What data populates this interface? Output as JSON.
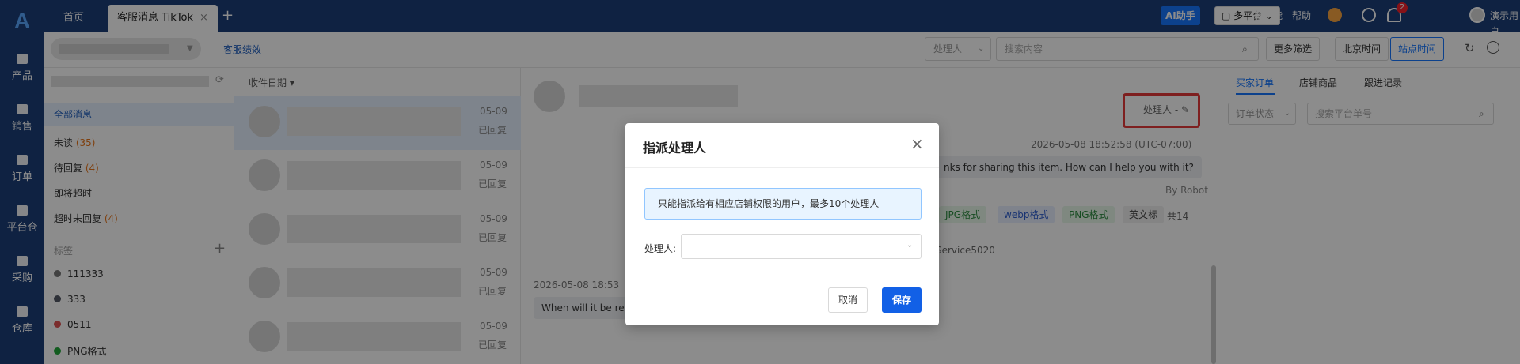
{
  "rail": {
    "items": [
      {
        "label": "产品"
      },
      {
        "label": "销售"
      },
      {
        "label": "订单"
      },
      {
        "label": "平台仓"
      },
      {
        "label": "采购"
      },
      {
        "label": "仓库"
      }
    ]
  },
  "topbar": {
    "tabs": [
      {
        "label": "首页",
        "active": false
      },
      {
        "label": "客服消息 TikTok",
        "active": true
      }
    ],
    "tab_close": "×",
    "add_tab": "+",
    "ai_label": "AI助手",
    "platform_label": "多平台",
    "new_features": "新功能",
    "help": "帮助",
    "notification_count": "2",
    "user_name": "演示用户"
  },
  "subbar": {
    "kefu_link": "客服绩效",
    "assignee_placeholder": "处理人",
    "search_placeholder": "搜索内容",
    "more_filter": "更多筛选",
    "beijing_time": "北京时间",
    "site_time": "站点时间"
  },
  "filters": {
    "items": [
      {
        "label": "全部消息",
        "count": ""
      },
      {
        "label": "未读",
        "count": "(35)"
      },
      {
        "label": "待回复",
        "count": "(4)"
      },
      {
        "label": "即将超时",
        "count": ""
      },
      {
        "label": "超时未回复",
        "count": "(4)"
      }
    ],
    "tags_header": "标签",
    "tags": [
      {
        "label": "111333",
        "color": "#777777"
      },
      {
        "label": "333",
        "color": "#555a66"
      },
      {
        "label": "0511",
        "color": "#e05252"
      },
      {
        "label": "PNG格式",
        "color": "#22a83a"
      }
    ]
  },
  "messages": {
    "header": "收件日期",
    "rows": [
      {
        "date": "05-09",
        "status": "已回复"
      },
      {
        "date": "05-09",
        "status": "已回复"
      },
      {
        "date": "05-09",
        "status": "已回复"
      },
      {
        "date": "05-09",
        "status": "已回复"
      },
      {
        "date": "05-09",
        "status": "已回复"
      }
    ]
  },
  "chat": {
    "assignee_label": "处理人  -",
    "timestamp1": "2026-05-08 18:52:58 (UTC-07:00)",
    "bubble1": "nks for sharing this item. How can I help you with it?",
    "bot_label": "By Robot",
    "chips": [
      {
        "label": "JPG格式",
        "bg": "#e7f7e9",
        "fg": "#2b8a3e"
      },
      {
        "label": "webp格式",
        "bg": "#e8efff",
        "fg": "#2f5fd0"
      },
      {
        "label": "PNG格式",
        "bg": "#e7f7e9",
        "fg": "#2b8a3e"
      },
      {
        "label": "英文标",
        "bg": "#f0f0f0",
        "fg": "#444444"
      }
    ],
    "chip_total": "共14",
    "service_text": "Service5020",
    "timestamp2": "2026-05-08 18:53",
    "bubble2": "When will it be re"
  },
  "rightpanel": {
    "tabs": [
      "买家订单",
      "店铺商品",
      "跟进记录"
    ],
    "order_status_placeholder": "订单状态",
    "order_search_placeholder": "搜索平台单号"
  },
  "modal": {
    "title": "指派处理人",
    "close": "×",
    "notice": "只能指派给有相应店铺权限的用户，最多10个处理人",
    "field_label": "处理人:",
    "cancel": "取消",
    "save": "保存"
  }
}
